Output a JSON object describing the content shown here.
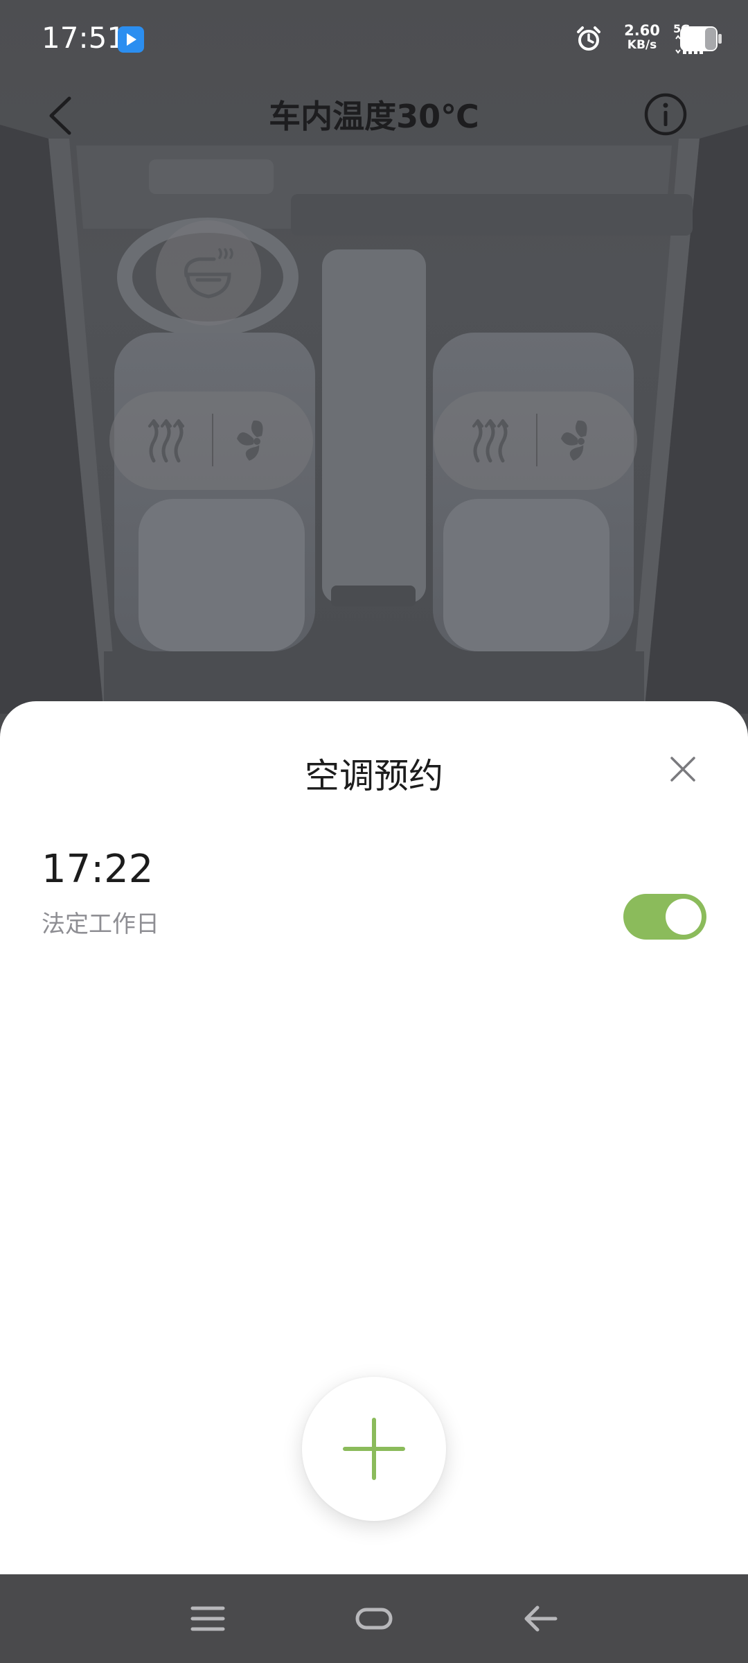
{
  "status_bar": {
    "time": "17:51",
    "net_speed_value": "2.60",
    "net_speed_unit": "KB/s",
    "network_type": "5G",
    "icons": [
      "app-notification-icon",
      "alarm-icon",
      "signal-icon",
      "battery-icon"
    ]
  },
  "header": {
    "title": "车内温度30℃",
    "back_icon": "chevron-left-icon",
    "info_icon": "info-icon"
  },
  "climate_controls": {
    "steering_wheel_heat_icon": "steering-wheel-heat-icon",
    "seats": [
      {
        "side": "left",
        "heat_icon": "seat-heat-icon",
        "vent_icon": "seat-vent-fan-icon"
      },
      {
        "side": "right",
        "heat_icon": "seat-heat-icon",
        "vent_icon": "seat-vent-fan-icon"
      }
    ]
  },
  "sheet": {
    "title": "空调预约",
    "close_icon": "close-icon",
    "schedules": [
      {
        "time": "17:22",
        "repeat": "法定工作日",
        "enabled": true
      }
    ],
    "add_icon": "plus-icon"
  },
  "nav_bar": {
    "icons": [
      "menu-icon",
      "home-icon",
      "back-arrow-icon"
    ]
  },
  "colors": {
    "accent": "#8bbb5b",
    "overlay": "#4d4e51",
    "nav_bar": "#4a4a4c"
  }
}
